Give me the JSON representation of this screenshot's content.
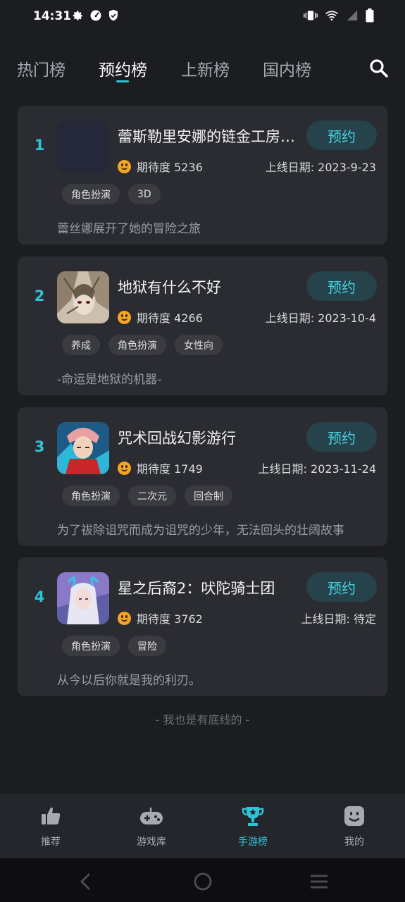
{
  "status_bar": {
    "time": "14:31"
  },
  "tabs": [
    {
      "label": "热门榜",
      "active": false
    },
    {
      "label": "预约榜",
      "active": true
    },
    {
      "label": "上新榜",
      "active": false
    },
    {
      "label": "国内榜",
      "active": false
    }
  ],
  "games": [
    {
      "rank": "1",
      "title": "蕾斯勒里安娜的链金工房~被遗忘的炼金术与极夜的解放者~",
      "button": "预约",
      "expect_label": "期待度 5236",
      "release": "上线日期: 2023-9-23",
      "tags": [
        "角色扮演",
        "3D"
      ],
      "desc": "蕾丝娜展开了她的冒险之旅"
    },
    {
      "rank": "2",
      "title": "地狱有什么不好",
      "button": "预约",
      "expect_label": "期待度 4266",
      "release": "上线日期: 2023-10-4",
      "tags": [
        "养成",
        "角色扮演",
        "女性向"
      ],
      "desc": "-命运是地狱的机器-"
    },
    {
      "rank": "3",
      "title": "咒术回战幻影游行",
      "button": "预约",
      "expect_label": "期待度 1749",
      "release": "上线日期: 2023-11-24",
      "tags": [
        "角色扮演",
        "二次元",
        "回合制"
      ],
      "desc": "为了祓除诅咒而成为诅咒的少年，无法回头的壮阔故事"
    },
    {
      "rank": "4",
      "title": "星之后裔2：吠陀骑士团",
      "button": "预约",
      "expect_label": "期待度 3762",
      "release": "上线日期: 待定",
      "tags": [
        "角色扮演",
        "冒险"
      ],
      "desc": "从今以后你就是我的利刃。"
    }
  ],
  "footer_note": "- 我也是有底线的 -",
  "bottom_nav": [
    {
      "label": "推荐",
      "icon": "thumbs-up-icon",
      "active": false
    },
    {
      "label": "游戏库",
      "icon": "gamepad-icon",
      "active": false
    },
    {
      "label": "手游榜",
      "icon": "trophy-icon",
      "active": true
    },
    {
      "label": "我的",
      "icon": "smiley-face-icon",
      "active": false
    }
  ],
  "colors": {
    "accent": "#2ec4d6",
    "background": "#1c1d21",
    "card": "#2b2c31"
  }
}
